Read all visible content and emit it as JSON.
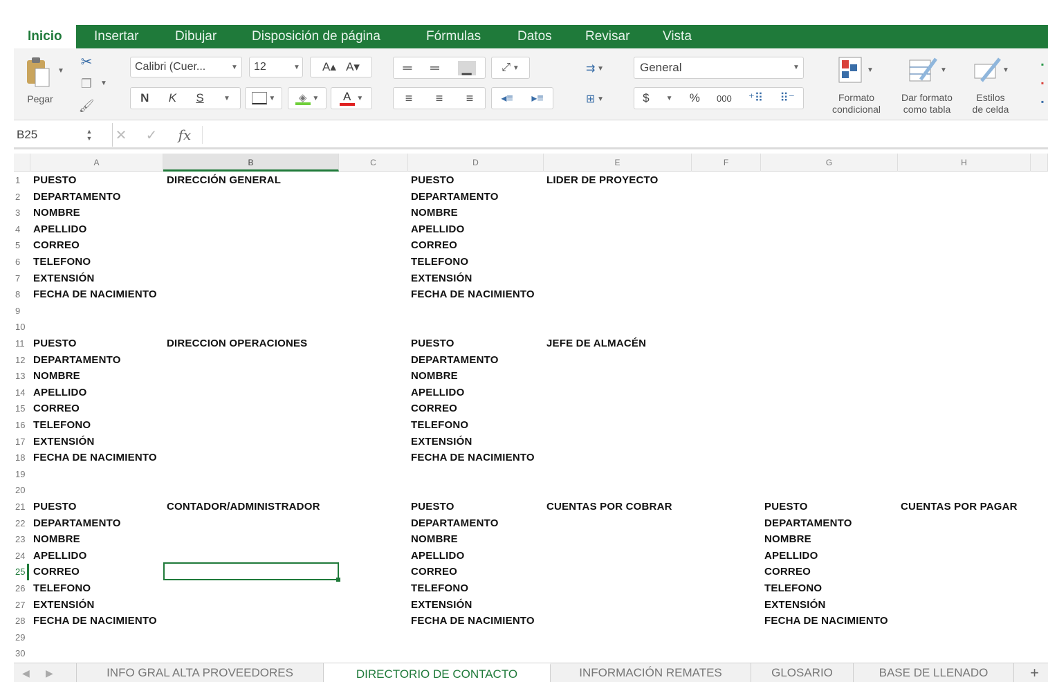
{
  "ribbon_tabs": [
    "Inicio",
    "Insertar",
    "Dibujar",
    "Disposición de página",
    "Fórmulas",
    "Datos",
    "Revisar",
    "Vista"
  ],
  "clipboard": {
    "paste_label": "Pegar"
  },
  "font": {
    "name": "Calibri (Cuer...",
    "size": "12",
    "bold": "N",
    "italic": "K",
    "underline": "S"
  },
  "number_format": {
    "value": "General",
    "percent": "%",
    "thousands": "000",
    "currency": "$"
  },
  "styles": {
    "conditional_line1": "Formato",
    "conditional_line2": "condicional",
    "table_line1": "Dar formato",
    "table_line2": "como tabla",
    "cell_line1": "Estilos",
    "cell_line2": "de celda"
  },
  "formula_bar": {
    "name_box": "B25",
    "fx": "fx"
  },
  "columns": [
    "A",
    "B",
    "C",
    "D",
    "E",
    "F",
    "G",
    "H"
  ],
  "rows": [
    "1",
    "2",
    "3",
    "4",
    "5",
    "6",
    "7",
    "8",
    "9",
    "10",
    "11",
    "12",
    "13",
    "14",
    "15",
    "16",
    "17",
    "18",
    "19",
    "20",
    "21",
    "22",
    "23",
    "24",
    "25",
    "26",
    "27",
    "28",
    "29",
    "30"
  ],
  "block_labels": [
    "PUESTO",
    "DEPARTAMENTO",
    "NOMBRE",
    "APELLIDO",
    "CORREO",
    "TELEFONO",
    "EXTENSIÓN",
    "FECHA DE NACIMIENTO"
  ],
  "blocks": {
    "b1_left": "DIRECCIÓN GENERAL",
    "b1_right": "LIDER DE PROYECTO",
    "b2_left": "DIRECCION OPERACIONES",
    "b2_right": "JEFE DE ALMACÉN",
    "b3_left": "CONTADOR/ADMINISTRADOR",
    "b3_mid": "CUENTAS POR COBRAR",
    "b3_right": "CUENTAS POR PAGAR"
  },
  "sheets": [
    "INFO GRAL ALTA PROVEEDORES",
    "DIRECTORIO DE CONTACTO",
    "INFORMACIÓN REMATES",
    "GLOSARIO",
    "BASE DE LLENADO"
  ],
  "add_sheet": "+",
  "colors": {
    "accent": "#1f7a3a"
  }
}
